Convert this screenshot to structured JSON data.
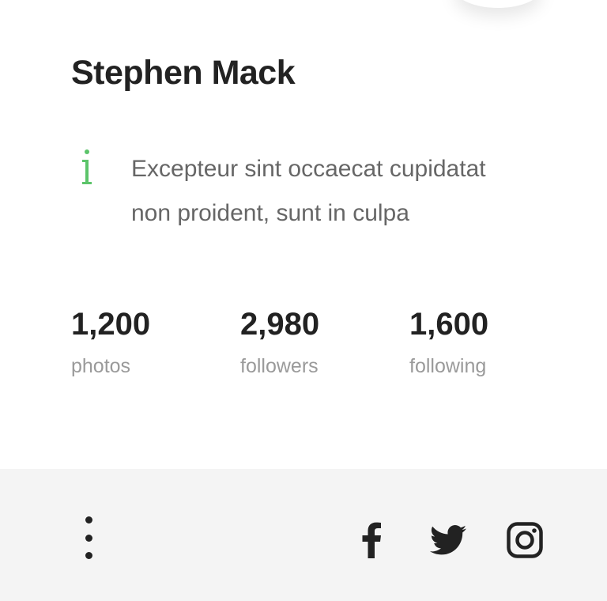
{
  "profile": {
    "name": "Stephen Mack",
    "bio_line1": "Excepteur sint occaecat cupidatat",
    "bio_line2": "non proident, sunt in culpa"
  },
  "stats": [
    {
      "value": "1,200",
      "label": "photos"
    },
    {
      "value": "2,980",
      "label": "followers"
    },
    {
      "value": "1,600",
      "label": "following"
    }
  ],
  "footer": {
    "menu_icon": "more-vertical-icon",
    "social_icons": [
      "facebook-icon",
      "twitter-icon",
      "instagram-icon"
    ]
  },
  "colors": {
    "text_primary": "#222222",
    "text_secondary": "#666666",
    "text_muted": "#9a9a9a",
    "accent_info": "#5cc46a",
    "footer_bg": "#f4f4f4"
  }
}
